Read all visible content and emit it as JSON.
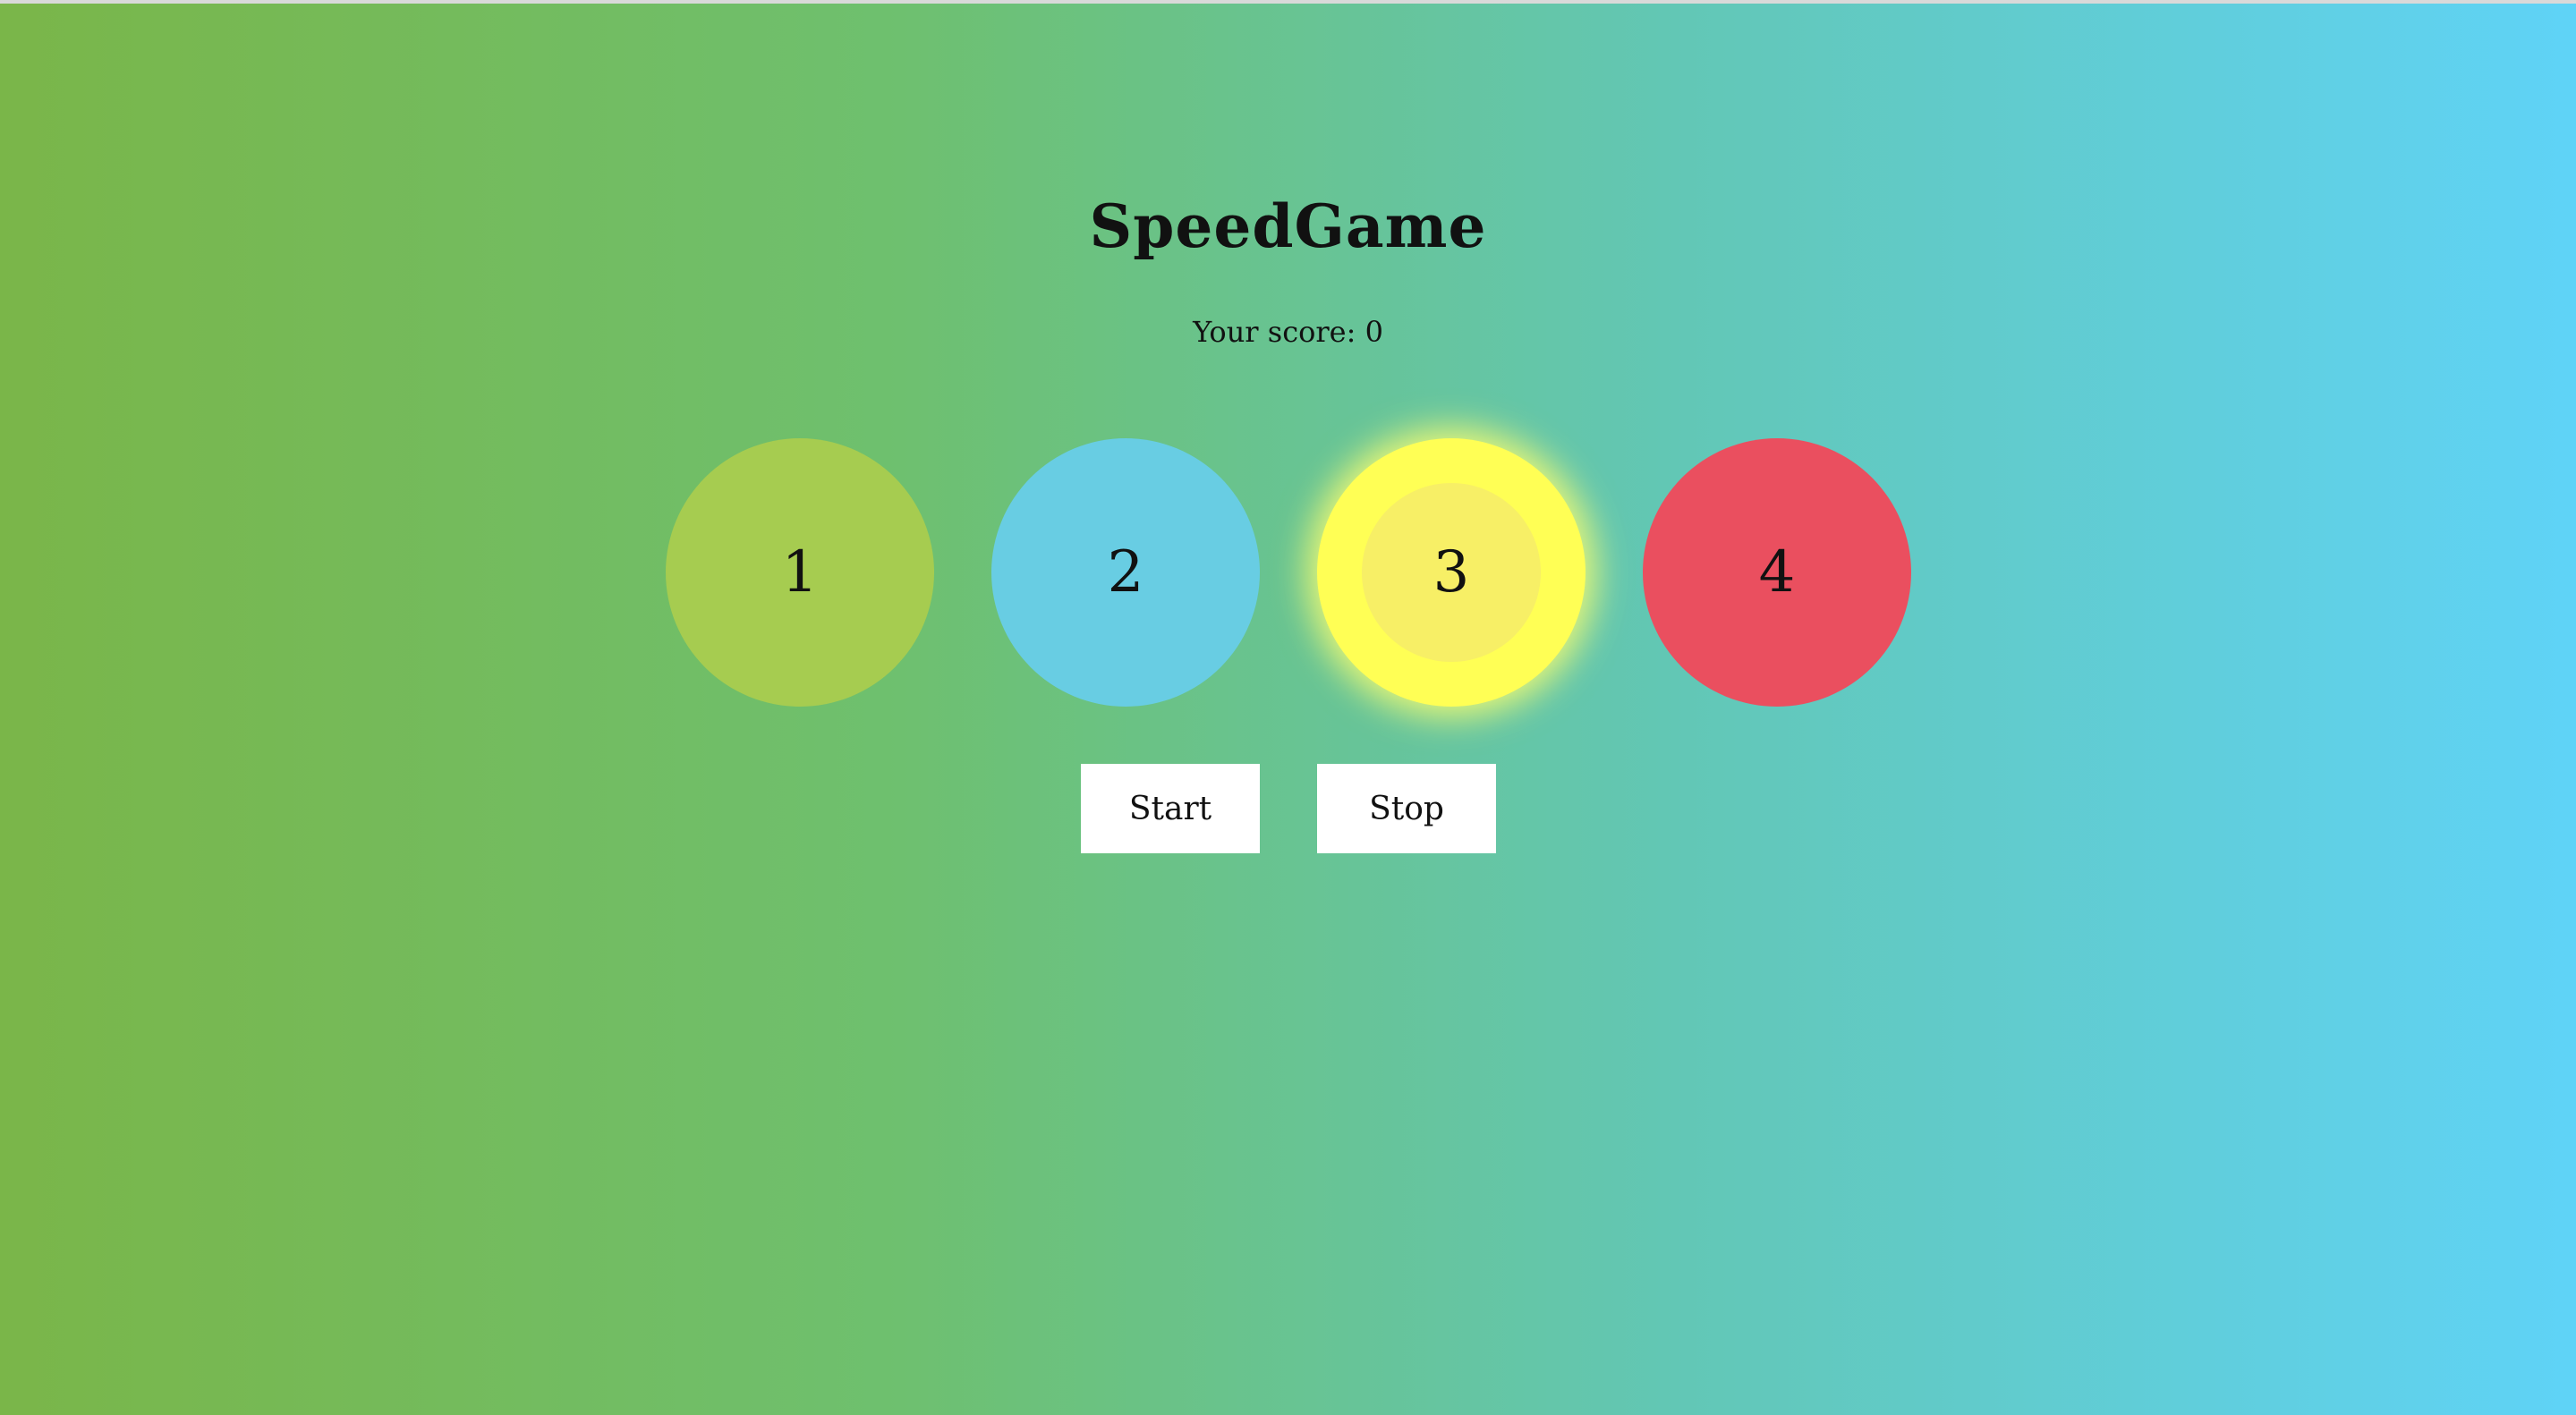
{
  "title": "SpeedGame",
  "score": {
    "text": "Your score: 0"
  },
  "circles": [
    {
      "label": "1",
      "color": "#a6cc50"
    },
    {
      "label": "2",
      "color": "#68cde3"
    },
    {
      "label": "3",
      "color": "#ffff55",
      "inner_color": "#f7ef66",
      "active": true
    },
    {
      "label": "4",
      "color": "#ea4f5f"
    }
  ],
  "buttons": {
    "start_label": "Start",
    "stop_label": "Stop"
  }
}
